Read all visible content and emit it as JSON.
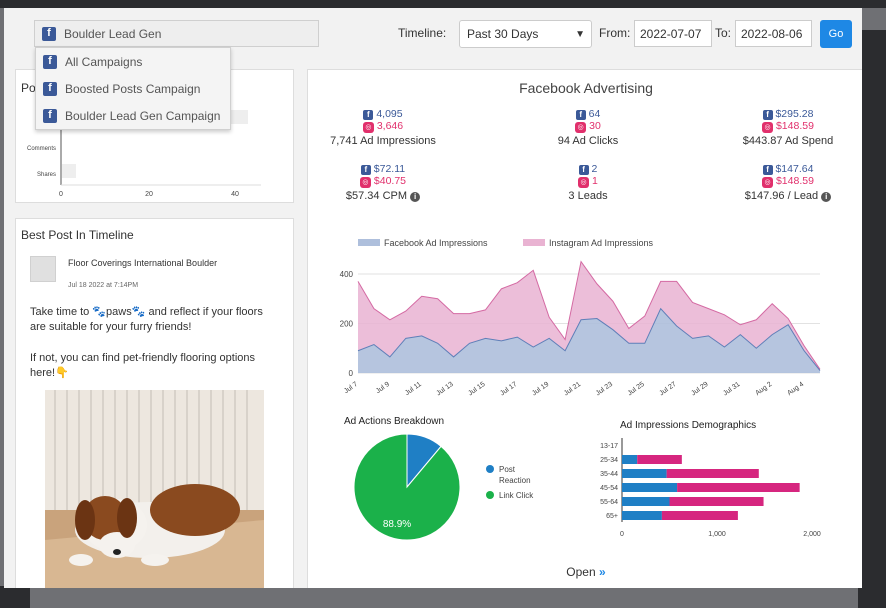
{
  "campaign": {
    "selected": "Boulder Lead Gen",
    "options": [
      "All Campaigns",
      "Boosted Posts Campaign",
      "Boulder Lead Gen Campaign"
    ]
  },
  "timeline": {
    "label": "Timeline:",
    "value": "Past 30 Days",
    "from_label": "From:",
    "from": "2022-07-07",
    "to_label": "To:",
    "to": "2022-08-06",
    "go": "Go"
  },
  "posts_panel": {
    "title_fragment": "Po",
    "rows": [
      "Comments",
      "Shares"
    ],
    "ticks": [
      "0",
      "20",
      "40"
    ]
  },
  "best_post": {
    "title": "Best Post In Timeline",
    "author": "Floor Coverings International Boulder",
    "date": "Jul 18 2022 at 7:14PM",
    "text1": "Take time to 🐾paws🐾 and reflect if your floors are suitable for your furry friends!",
    "text2": "If not, you can find pet-friendly flooring options here!👇"
  },
  "fb": {
    "title": "Facebook Advertising",
    "metrics": [
      {
        "fb": "4,095",
        "ig": "3,646",
        "total": "7,741 Ad Impressions",
        "info": false
      },
      {
        "fb": "64",
        "ig": "30",
        "total": "94 Ad Clicks",
        "info": false
      },
      {
        "fb": "$295.28",
        "ig": "$148.59",
        "total": "$443.87 Ad Spend",
        "info": false
      },
      {
        "fb": "$72.11",
        "ig": "$40.75",
        "total": "$57.34 CPM",
        "info": true
      },
      {
        "fb": "2",
        "ig": "1",
        "total": "3 Leads",
        "info": false
      },
      {
        "fb": "$147.64",
        "ig": "$148.59",
        "total": "$147.96 / Lead",
        "info": true
      }
    ],
    "open_label": "Open"
  },
  "colors": {
    "facebook": "#3b5998",
    "instagram": "#e1306c",
    "fb_area": "#aebfdc",
    "ig_area": "#e9b3d2",
    "pie_green": "#1bb14a",
    "pie_blue": "#1f7fc5",
    "bar_blue": "#1f7fc5",
    "bar_pink": "#d6267f"
  },
  "chart_data": [
    {
      "type": "area",
      "legend": [
        "Facebook Ad Impressions",
        "Instagram Ad Impressions"
      ],
      "x": [
        "Jul 7",
        "Jul 8",
        "Jul 9",
        "Jul 10",
        "Jul 11",
        "Jul 12",
        "Jul 13",
        "Jul 14",
        "Jul 15",
        "Jul 16",
        "Jul 17",
        "Jul 18",
        "Jul 19",
        "Jul 20",
        "Jul 21",
        "Jul 22",
        "Jul 23",
        "Jul 24",
        "Jul 25",
        "Jul 26",
        "Jul 27",
        "Jul 28",
        "Jul 29",
        "Jul 30",
        "Jul 31",
        "Aug 1",
        "Aug 2",
        "Aug 3",
        "Aug 4",
        "Aug 5"
      ],
      "x_tick_labels": [
        "Jul 7",
        "Jul 9",
        "Jul 11",
        "Jul 13",
        "Jul 15",
        "Jul 17",
        "Jul 19",
        "Jul 21",
        "Jul 23",
        "Jul 25",
        "Jul 27",
        "Jul 29",
        "Jul 31",
        "Aug 2",
        "Aug 4"
      ],
      "ytick_labels": [
        "0",
        "200",
        "400"
      ],
      "ylim": [
        0,
        400
      ],
      "series": [
        {
          "name": "Facebook Ad Impressions",
          "values": [
            90,
            115,
            65,
            140,
            150,
            120,
            65,
            120,
            140,
            130,
            145,
            105,
            140,
            90,
            215,
            220,
            175,
            120,
            120,
            260,
            190,
            140,
            150,
            105,
            155,
            100,
            155,
            195,
            90,
            10
          ]
        },
        {
          "name": "Instagram Ad Impressions",
          "values": [
            280,
            145,
            150,
            110,
            160,
            180,
            175,
            120,
            115,
            210,
            220,
            310,
            85,
            45,
            235,
            140,
            115,
            60,
            110,
            110,
            180,
            145,
            110,
            130,
            40,
            115,
            125,
            25,
            20,
            5
          ]
        }
      ]
    },
    {
      "type": "pie",
      "title": "Ad Actions Breakdown",
      "categories": [
        "Post Reaction",
        "Link Click"
      ],
      "values": [
        11.1,
        88.9
      ],
      "slice_label": "88.9%"
    },
    {
      "type": "bar",
      "orientation": "horizontal",
      "stacked": true,
      "title": "Ad Impressions Demographics",
      "categories": [
        "13-17",
        "25-34",
        "35-44",
        "45-54",
        "55-64",
        "65+"
      ],
      "xtick_labels": [
        "0",
        "1,000",
        "2,000"
      ],
      "xlim": [
        0,
        2000
      ],
      "series": [
        {
          "name": "Facebook",
          "values": [
            0,
            160,
            470,
            580,
            500,
            420
          ]
        },
        {
          "name": "Instagram",
          "values": [
            0,
            470,
            970,
            1290,
            990,
            800
          ]
        }
      ]
    }
  ]
}
